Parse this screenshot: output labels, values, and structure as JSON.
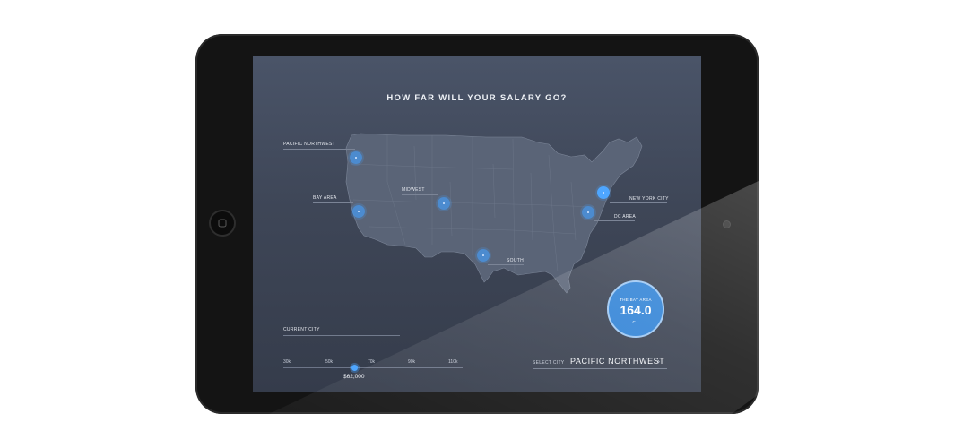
{
  "app": {
    "title": "HOW FAR WILL YOUR SALARY GO?"
  },
  "regions": [
    {
      "id": "pacific-northwest",
      "label": "PACIFIC NORTHWEST"
    },
    {
      "id": "bay-area",
      "label": "BAY AREA"
    },
    {
      "id": "midwest",
      "label": "MIDWEST"
    },
    {
      "id": "south",
      "label": "SOUTH"
    },
    {
      "id": "new-york-city",
      "label": "NEW YORK CITY"
    },
    {
      "id": "dc-area",
      "label": "DC AREA"
    }
  ],
  "badge": {
    "region": "THE BAY AREA",
    "value": "164.0",
    "unit": "C.I."
  },
  "current_city": {
    "label": "CURRENT CITY"
  },
  "salary_slider": {
    "ticks": [
      "30k",
      "50k",
      "70k",
      "90k",
      "110k"
    ],
    "value_label": "$62,000",
    "value": 62000
  },
  "select_city": {
    "label": "SELECT CITY",
    "value": "PACIFIC NORTHWEST",
    "arrow": "›"
  },
  "colors": {
    "screen_bg": "#3e4657",
    "accent": "#4ea6ff",
    "badge": "#2f82d6",
    "tablet_bezel": "#141414"
  },
  "icons": {
    "home": "home-button-icon",
    "camera": "front-camera-icon",
    "pin": "location-pin-icon",
    "chevron": "chevron-right-icon"
  }
}
